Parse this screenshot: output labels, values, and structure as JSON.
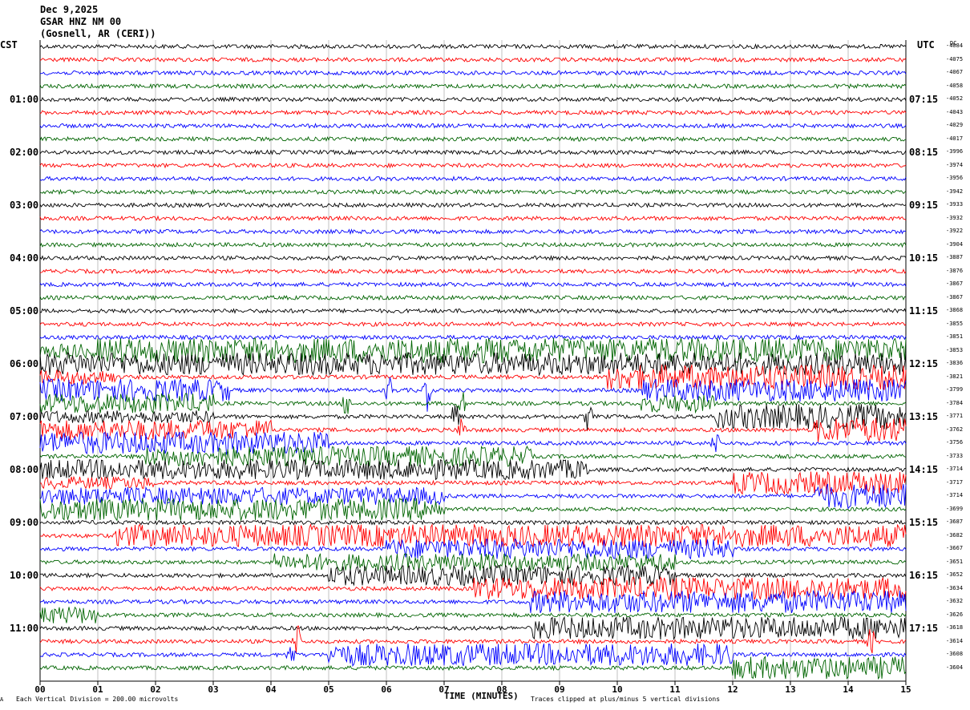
{
  "header": {
    "date": "Dec 9,2025",
    "station": "GSAR HNZ NM 00",
    "location": "(Gosnell, AR (CERI))"
  },
  "left_tz": "CST",
  "right_tz": "UTC",
  "dc_label": "DC",
  "footer": {
    "scale_note": "Each Vertical Division =  200.00 microvolts",
    "x_axis_title": "TIME (MINUTES)",
    "clip_note": "Traces clipped at plus/minus 5 vertical divisions",
    "corner_mark": "A"
  },
  "colors": {
    "black": "#000000",
    "red": "#ff0000",
    "blue": "#0000ff",
    "green": "#006400"
  },
  "chart_data": {
    "type": "line",
    "x_ticks": [
      "00",
      "01",
      "02",
      "03",
      "04",
      "05",
      "06",
      "07",
      "08",
      "09",
      "10",
      "11",
      "12",
      "13",
      "14",
      "15"
    ],
    "xlim": [
      0,
      15
    ],
    "left_hour_labels": [
      "01:00",
      "02:00",
      "03:00",
      "04:00",
      "05:00",
      "06:00",
      "07:00",
      "08:00",
      "09:00",
      "10:00",
      "11:00"
    ],
    "right_hour_labels": [
      "07:15",
      "08:15",
      "09:15",
      "10:15",
      "11:15",
      "12:15",
      "13:15",
      "14:15",
      "15:15",
      "16:15",
      "17:15"
    ],
    "trace_colors": [
      "black",
      "red",
      "blue",
      "green"
    ],
    "trace_count": 48,
    "dc_offsets": [
      "-4084",
      "-4075",
      "-4067",
      "-4058",
      "-4052",
      "-4043",
      "-4029",
      "-4017",
      "-3996",
      "-3974",
      "-3956",
      "-3942",
      "-3933",
      "-3932",
      "-3922",
      "-3904",
      "-3887",
      "-3876",
      "-3867",
      "-3867",
      "-3868",
      "-3855",
      "-3851",
      "-3853",
      "-3836",
      "-3821",
      "-3799",
      "-3784",
      "-3771",
      "-3762",
      "-3756",
      "-3733",
      "-3714",
      "-3717",
      "-3714",
      "-3699",
      "-3687",
      "-3682",
      "-3667",
      "-3651",
      "-3652",
      "-3634",
      "-3632",
      "-3626",
      "-3618",
      "-3614",
      "-3608",
      "-3604"
    ],
    "noise_segments": [
      {
        "trace": 23,
        "from": 0,
        "to": 1,
        "amp": 0.6
      },
      {
        "trace": 23,
        "from": 1,
        "to": 15,
        "amp": 1.0
      },
      {
        "trace": 24,
        "from": 0,
        "to": 15,
        "amp": 0.9
      },
      {
        "trace": 25,
        "from": 0,
        "to": 1.3,
        "amp": 0.6
      },
      {
        "trace": 25,
        "from": 9.8,
        "to": 15,
        "amp": 1.0
      },
      {
        "trace": 26,
        "from": 0,
        "to": 3.3,
        "amp": 0.9
      },
      {
        "trace": 26,
        "from": 10.4,
        "to": 15,
        "amp": 0.9
      },
      {
        "trace": 27,
        "from": 0,
        "to": 3.0,
        "amp": 0.8
      },
      {
        "trace": 27,
        "from": 10.4,
        "to": 11.7,
        "amp": 0.7
      },
      {
        "trace": 28,
        "from": 0,
        "to": 3.0,
        "amp": 0.5
      },
      {
        "trace": 28,
        "from": 11.7,
        "to": 15,
        "amp": 1.0
      },
      {
        "trace": 29,
        "from": 0,
        "to": 4.0,
        "amp": 0.8
      },
      {
        "trace": 29,
        "from": 13.4,
        "to": 15,
        "amp": 1.0
      },
      {
        "trace": 30,
        "from": 0,
        "to": 5.0,
        "amp": 0.9
      },
      {
        "trace": 31,
        "from": 1.8,
        "to": 8.5,
        "amp": 0.8
      },
      {
        "trace": 32,
        "from": 0,
        "to": 9.5,
        "amp": 0.8
      },
      {
        "trace": 33,
        "from": 0,
        "to": 2.0,
        "amp": 0.5
      },
      {
        "trace": 33,
        "from": 12.0,
        "to": 15,
        "amp": 0.9
      },
      {
        "trace": 34,
        "from": 0,
        "to": 7.0,
        "amp": 0.7
      },
      {
        "trace": 34,
        "from": 13.4,
        "to": 15,
        "amp": 1.0
      },
      {
        "trace": 35,
        "from": 0,
        "to": 7.0,
        "amp": 0.9
      },
      {
        "trace": 37,
        "from": 1.3,
        "to": 15,
        "amp": 0.9
      },
      {
        "trace": 38,
        "from": 6.0,
        "to": 12.0,
        "amp": 0.8
      },
      {
        "trace": 39,
        "from": 4.0,
        "to": 11.0,
        "amp": 0.7
      },
      {
        "trace": 40,
        "from": 5.0,
        "to": 11.0,
        "amp": 0.8
      },
      {
        "trace": 41,
        "from": 7.5,
        "to": 15,
        "amp": 0.9
      },
      {
        "trace": 42,
        "from": 8.5,
        "to": 15,
        "amp": 0.9
      },
      {
        "trace": 43,
        "from": 0,
        "to": 1.0,
        "amp": 0.7
      },
      {
        "trace": 44,
        "from": 8.5,
        "to": 15,
        "amp": 0.9
      },
      {
        "trace": 46,
        "from": 5.0,
        "to": 12.0,
        "amp": 0.9
      },
      {
        "trace": 47,
        "from": 12.0,
        "to": 15,
        "amp": 0.9
      }
    ],
    "spikes": [
      {
        "trace": 26,
        "at": 6.05,
        "amp": 1.2
      },
      {
        "trace": 26,
        "at": 6.7,
        "amp": 1.6
      },
      {
        "trace": 27,
        "at": 5.3,
        "amp": 1.2
      },
      {
        "trace": 27,
        "at": 7.3,
        "amp": 1.3
      },
      {
        "trace": 28,
        "at": 7.2,
        "amp": 1.4
      },
      {
        "trace": 28,
        "at": 9.5,
        "amp": 1.2
      },
      {
        "trace": 29,
        "at": 7.3,
        "amp": 1.0
      },
      {
        "trace": 30,
        "at": 11.7,
        "amp": 1.0
      },
      {
        "trace": 45,
        "at": 4.45,
        "amp": 1.6
      },
      {
        "trace": 46,
        "at": 4.35,
        "amp": 1.3
      },
      {
        "trace": 45,
        "at": 14.4,
        "amp": 1.0
      }
    ]
  }
}
